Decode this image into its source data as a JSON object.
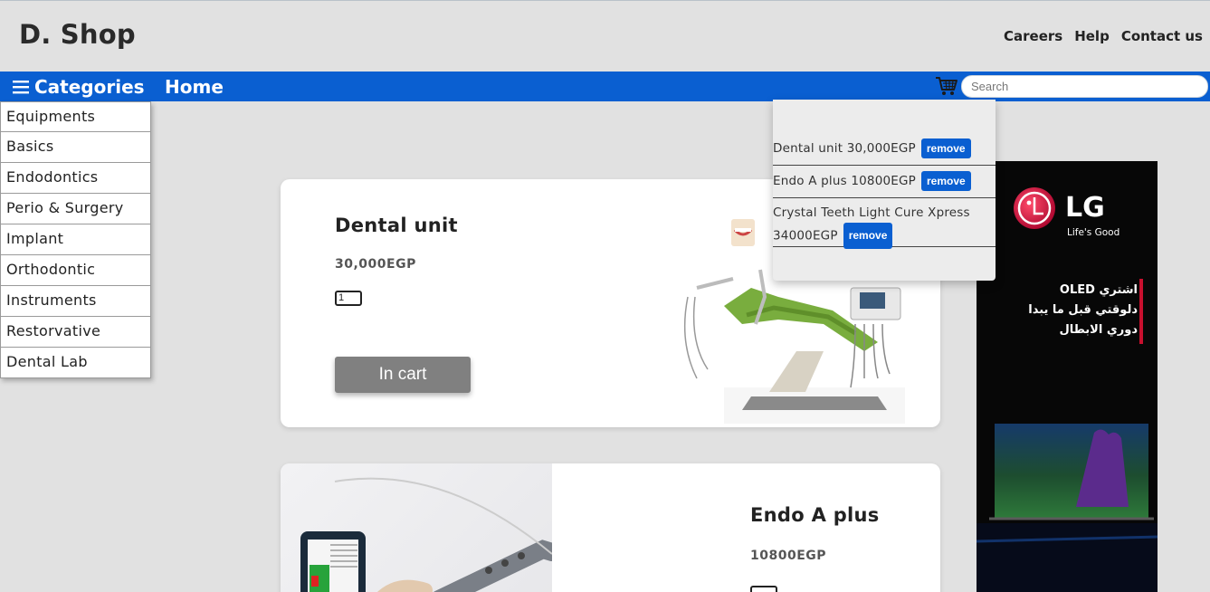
{
  "header": {
    "brand": "D. Shop",
    "links": [
      "Careers",
      "Help",
      "Contact us"
    ]
  },
  "navbar": {
    "categories_label": "Categories",
    "home_label": "Home",
    "search_placeholder": "Search",
    "accent_color": "#0a5fd1"
  },
  "categories": [
    "Equipments",
    "Basics",
    "Endodontics",
    "Perio & Surgery",
    "Implant",
    "Orthodontic",
    "Instruments",
    "Restorvative",
    "Dental Lab"
  ],
  "products": [
    {
      "name": "Dental unit",
      "price": "30,000EGP",
      "quantity": "1",
      "button_label": "In cart"
    },
    {
      "name": "Endo A plus",
      "price": "10800EGP",
      "quantity": ""
    }
  ],
  "cart": {
    "items": [
      {
        "text": "Dental unit 30,000EGP"
      },
      {
        "text": "Endo A plus 10800EGP"
      },
      {
        "text_line1": "Crystal Teeth Light Cure Xpress",
        "text_line2": "34000EGP"
      }
    ],
    "remove_label": "remove"
  },
  "ad": {
    "brand": "LG",
    "tagline": "Life's Good",
    "arabic_line1": "اشتري OLED",
    "arabic_line2": "دلوقتي قبل ما يبدا",
    "arabic_line3": "دوري الابطال"
  }
}
